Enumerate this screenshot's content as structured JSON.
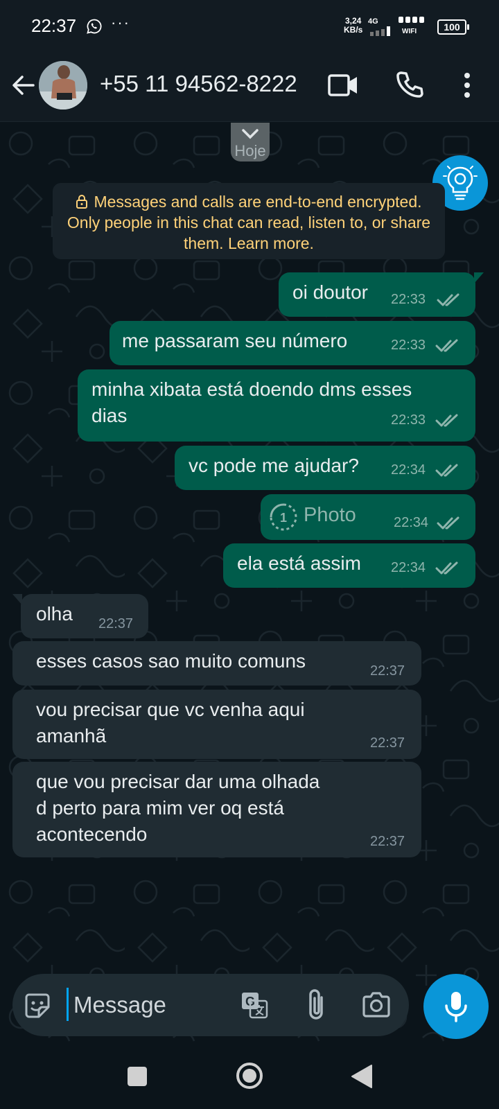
{
  "status_bar": {
    "time": "22:37",
    "network_speed_value": "3,24",
    "network_speed_unit": "KB/s",
    "network_type": "4G",
    "wifi_label": "WIFI",
    "battery": "100"
  },
  "header": {
    "contact": "+55 11 94562-8222",
    "icons": [
      "back-arrow-icon",
      "video-call-icon",
      "phone-icon",
      "more-vert-icon"
    ]
  },
  "chat": {
    "date_label": "Hoje",
    "encryption_notice": "Messages and calls are end-to-end encrypted. Only people in this chat can read, listen to, or share them. Learn more.",
    "messages": [
      {
        "direction": "out",
        "text": "oi doutor",
        "time": "22:33",
        "status": "read"
      },
      {
        "direction": "out",
        "text": "me passaram seu número",
        "time": "22:33",
        "status": "read"
      },
      {
        "direction": "out",
        "text": "minha xibata está doendo dms esses\ndias",
        "time": "22:33",
        "status": "read"
      },
      {
        "direction": "out",
        "text": "vc pode me ajudar?",
        "time": "22:34",
        "status": "read"
      },
      {
        "direction": "out",
        "type": "photo",
        "text": "Photo",
        "time": "22:34",
        "status": "read",
        "view_once_count": "1"
      },
      {
        "direction": "out",
        "text": "ela está assim",
        "time": "22:34",
        "status": "read"
      },
      {
        "direction": "in",
        "text": "olha",
        "time": "22:37"
      },
      {
        "direction": "in",
        "text": "esses casos sao muito comuns",
        "time": "22:37"
      },
      {
        "direction": "in",
        "text": "vou precisar que vc venha aqui\namanhã",
        "time": "22:37"
      },
      {
        "direction": "in",
        "text": "que vou precisar dar uma olhada\nd perto para mim ver oq está\nacontecendo",
        "time": "22:37"
      }
    ]
  },
  "composer": {
    "placeholder": "Message",
    "icons": [
      "sticker-icon",
      "translate-icon",
      "attach-icon",
      "camera-icon",
      "mic-icon"
    ]
  },
  "colors": {
    "outgoing_bubble": "#005c4b",
    "incoming_bubble": "#202c33",
    "accent": "#0a96d8",
    "encryption_text": "#ffd279",
    "read_ticks": "#8fb5ad"
  }
}
